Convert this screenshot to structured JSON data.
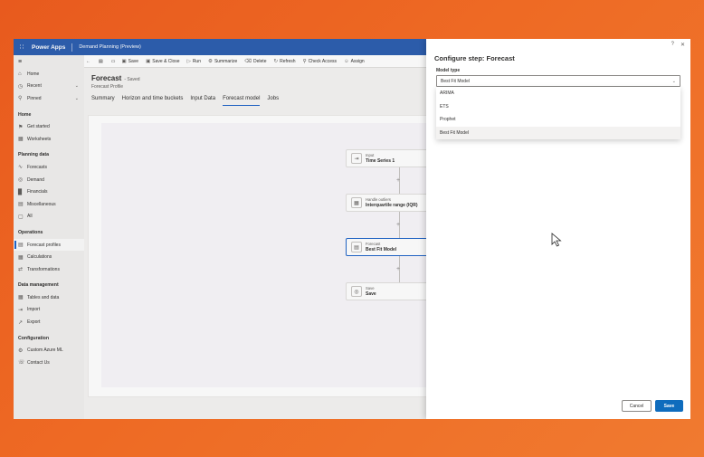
{
  "app": {
    "name": "Power Apps",
    "environment": "Demand Planning (Preview)"
  },
  "sidebar": {
    "items_top": [
      {
        "label": "Home",
        "icon": "home-icon"
      },
      {
        "label": "Recent",
        "icon": "clock-icon",
        "chevron": true
      },
      {
        "label": "Pinned",
        "icon": "pin-icon",
        "chevron": true
      }
    ],
    "sections": [
      {
        "heading": "Home",
        "items": [
          {
            "label": "Get started",
            "icon": "flag-icon"
          },
          {
            "label": "Worksheets",
            "icon": "grid-icon"
          }
        ]
      },
      {
        "heading": "Planning data",
        "items": [
          {
            "label": "Forecasts",
            "icon": "trend-icon"
          },
          {
            "label": "Demand",
            "icon": "demand-icon"
          },
          {
            "label": "Financials",
            "icon": "bar-chart-icon"
          },
          {
            "label": "Miscellaneous",
            "icon": "doc-icon"
          },
          {
            "label": "All",
            "icon": "all-icon"
          }
        ]
      },
      {
        "heading": "Operations",
        "items": [
          {
            "label": "Forecast profiles",
            "icon": "profile-icon",
            "active": true
          },
          {
            "label": "Calculations",
            "icon": "calc-icon"
          },
          {
            "label": "Transformations",
            "icon": "transform-icon"
          }
        ]
      },
      {
        "heading": "Data management",
        "items": [
          {
            "label": "Tables and data",
            "icon": "table-icon"
          },
          {
            "label": "Import",
            "icon": "import-icon"
          },
          {
            "label": "Export",
            "icon": "export-icon"
          }
        ]
      },
      {
        "heading": "Configuration",
        "items": [
          {
            "label": "Custom Azure ML",
            "icon": "gear-icon"
          },
          {
            "label": "Contact Us",
            "icon": "contact-icon"
          }
        ]
      }
    ]
  },
  "commands": [
    "Save",
    "Save & Close",
    "Run",
    "Summarize",
    "Delete",
    "Refresh",
    "Check Access",
    "Assign"
  ],
  "record": {
    "title": "Forecast",
    "status": "- Saved",
    "entity": "Forecast Profile"
  },
  "tabs": [
    {
      "label": "Summary"
    },
    {
      "label": "Horizon and time buckets"
    },
    {
      "label": "Input Data"
    },
    {
      "label": "Forecast model",
      "active": true
    },
    {
      "label": "Jobs"
    }
  ],
  "flow": [
    {
      "kind": "Input",
      "value": "Time Series 1"
    },
    {
      "kind": "Handle outliers",
      "value": "Interquartile range (IQR)"
    },
    {
      "kind": "Forecast",
      "value": "Best Fit Model",
      "selected": true
    },
    {
      "kind": "Save",
      "value": "Save"
    }
  ],
  "panel": {
    "title": "Configure step: Forecast",
    "field_label": "Model type",
    "selected_value": "Best Fit Model",
    "options": [
      "ARIMA",
      "ETS",
      "Prophet",
      "Best Fit Model"
    ],
    "cancel_label": "Cancel",
    "save_label": "Save"
  },
  "colors": {
    "accent": "#2266c9",
    "header": "#2e5fb0",
    "primary_button": "#0f6cbd"
  }
}
